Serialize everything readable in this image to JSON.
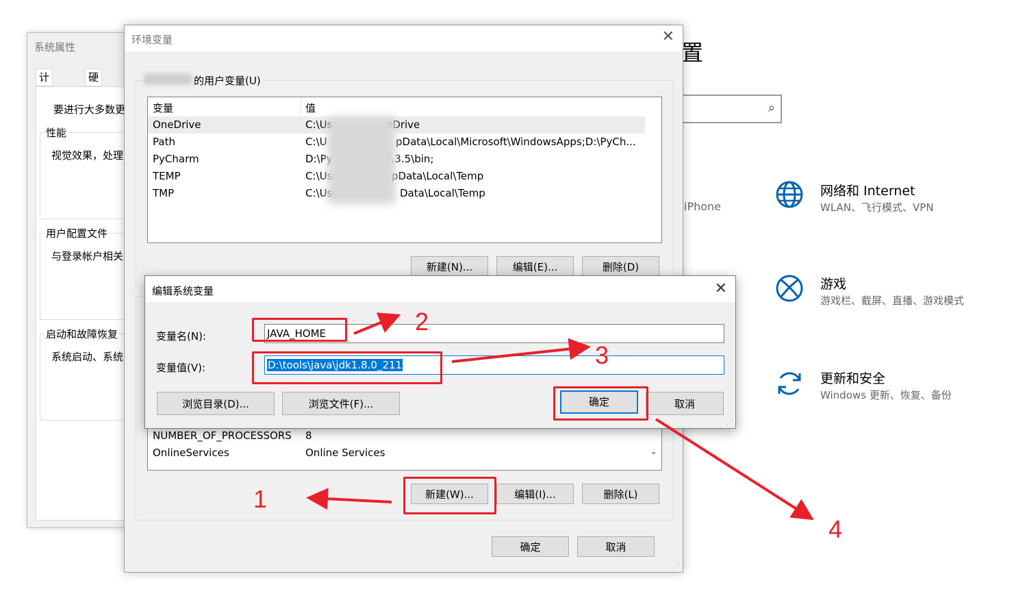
{
  "settings": {
    "title_fragment": "置",
    "iphone_fragment": "iPhone",
    "search_icon": "search-icon",
    "categories": [
      {
        "icon": "globe-icon",
        "title": "网络和 Internet",
        "desc": "WLAN、飞行模式、VPN"
      },
      {
        "icon": "xbox-icon",
        "title": "游戏",
        "desc": "游戏栏、截屏、直播、游戏模式"
      },
      {
        "icon": "sync-icon",
        "title": "更新和安全",
        "desc": "Windows 更新、恢复、备份"
      }
    ]
  },
  "system_properties": {
    "title": "系统属性",
    "tabs": [
      "计算机名",
      "硬件"
    ],
    "intro": "要进行大多数更",
    "performance": {
      "label": "性能",
      "text": "视觉效果，处理"
    },
    "user_profiles": {
      "label": "用户配置文件",
      "text": "与登录帐户相关"
    },
    "startup": {
      "label": "启动和故障恢复",
      "text": "系统启动、系统"
    }
  },
  "env_window": {
    "title": "环境变量",
    "close_glyph": "✕",
    "user_section_label": "的用户变量(U)",
    "columns": [
      "变量",
      "值"
    ],
    "user_vars": [
      {
        "name": "OneDrive",
        "value_prefix": "C:\\Us",
        "value_suffix": "eDrive"
      },
      {
        "name": "Path",
        "value_prefix": "C:\\U",
        "value_suffix": "pData\\Local\\Microsoft\\WindowsApps;D:\\PyCh..."
      },
      {
        "name": "PyCharm",
        "value_prefix": "D:\\Py",
        "value_suffix": "8.3.5\\bin;"
      },
      {
        "name": "TEMP",
        "value_prefix": "C:\\Use",
        "value_suffix": "pData\\Local\\Temp"
      },
      {
        "name": "TMP",
        "value_prefix": "C:\\Use",
        "value_suffix": "Data\\Local\\Temp"
      }
    ],
    "user_buttons": {
      "new": "新建(N)...",
      "edit": "编辑(E)...",
      "delete": "删除(D)"
    },
    "system_vars": [
      {
        "name": "NUMBER_OF_PROCESSORS",
        "value": "8"
      },
      {
        "name": "OnlineServices",
        "value": "Online Services"
      }
    ],
    "system_buttons": {
      "new": "新建(W)...",
      "edit": "编辑(I)...",
      "delete": "删除(L)"
    },
    "ok": "确定",
    "cancel": "取消"
  },
  "edit_dialog": {
    "title": "编辑系统变量",
    "close_glyph": "✕",
    "name_label": "变量名(N):",
    "name_value": "JAVA_HOME",
    "value_label": "变量值(V):",
    "value_value": "D:\\tools\\java\\jdk1.8.0_211",
    "browse_dir": "浏览目录(D)...",
    "browse_file": "浏览文件(F)...",
    "ok": "确定",
    "cancel": "取消"
  },
  "annotations": {
    "steps": [
      "1",
      "2",
      "3",
      "4"
    ],
    "color": "#e8202a"
  }
}
